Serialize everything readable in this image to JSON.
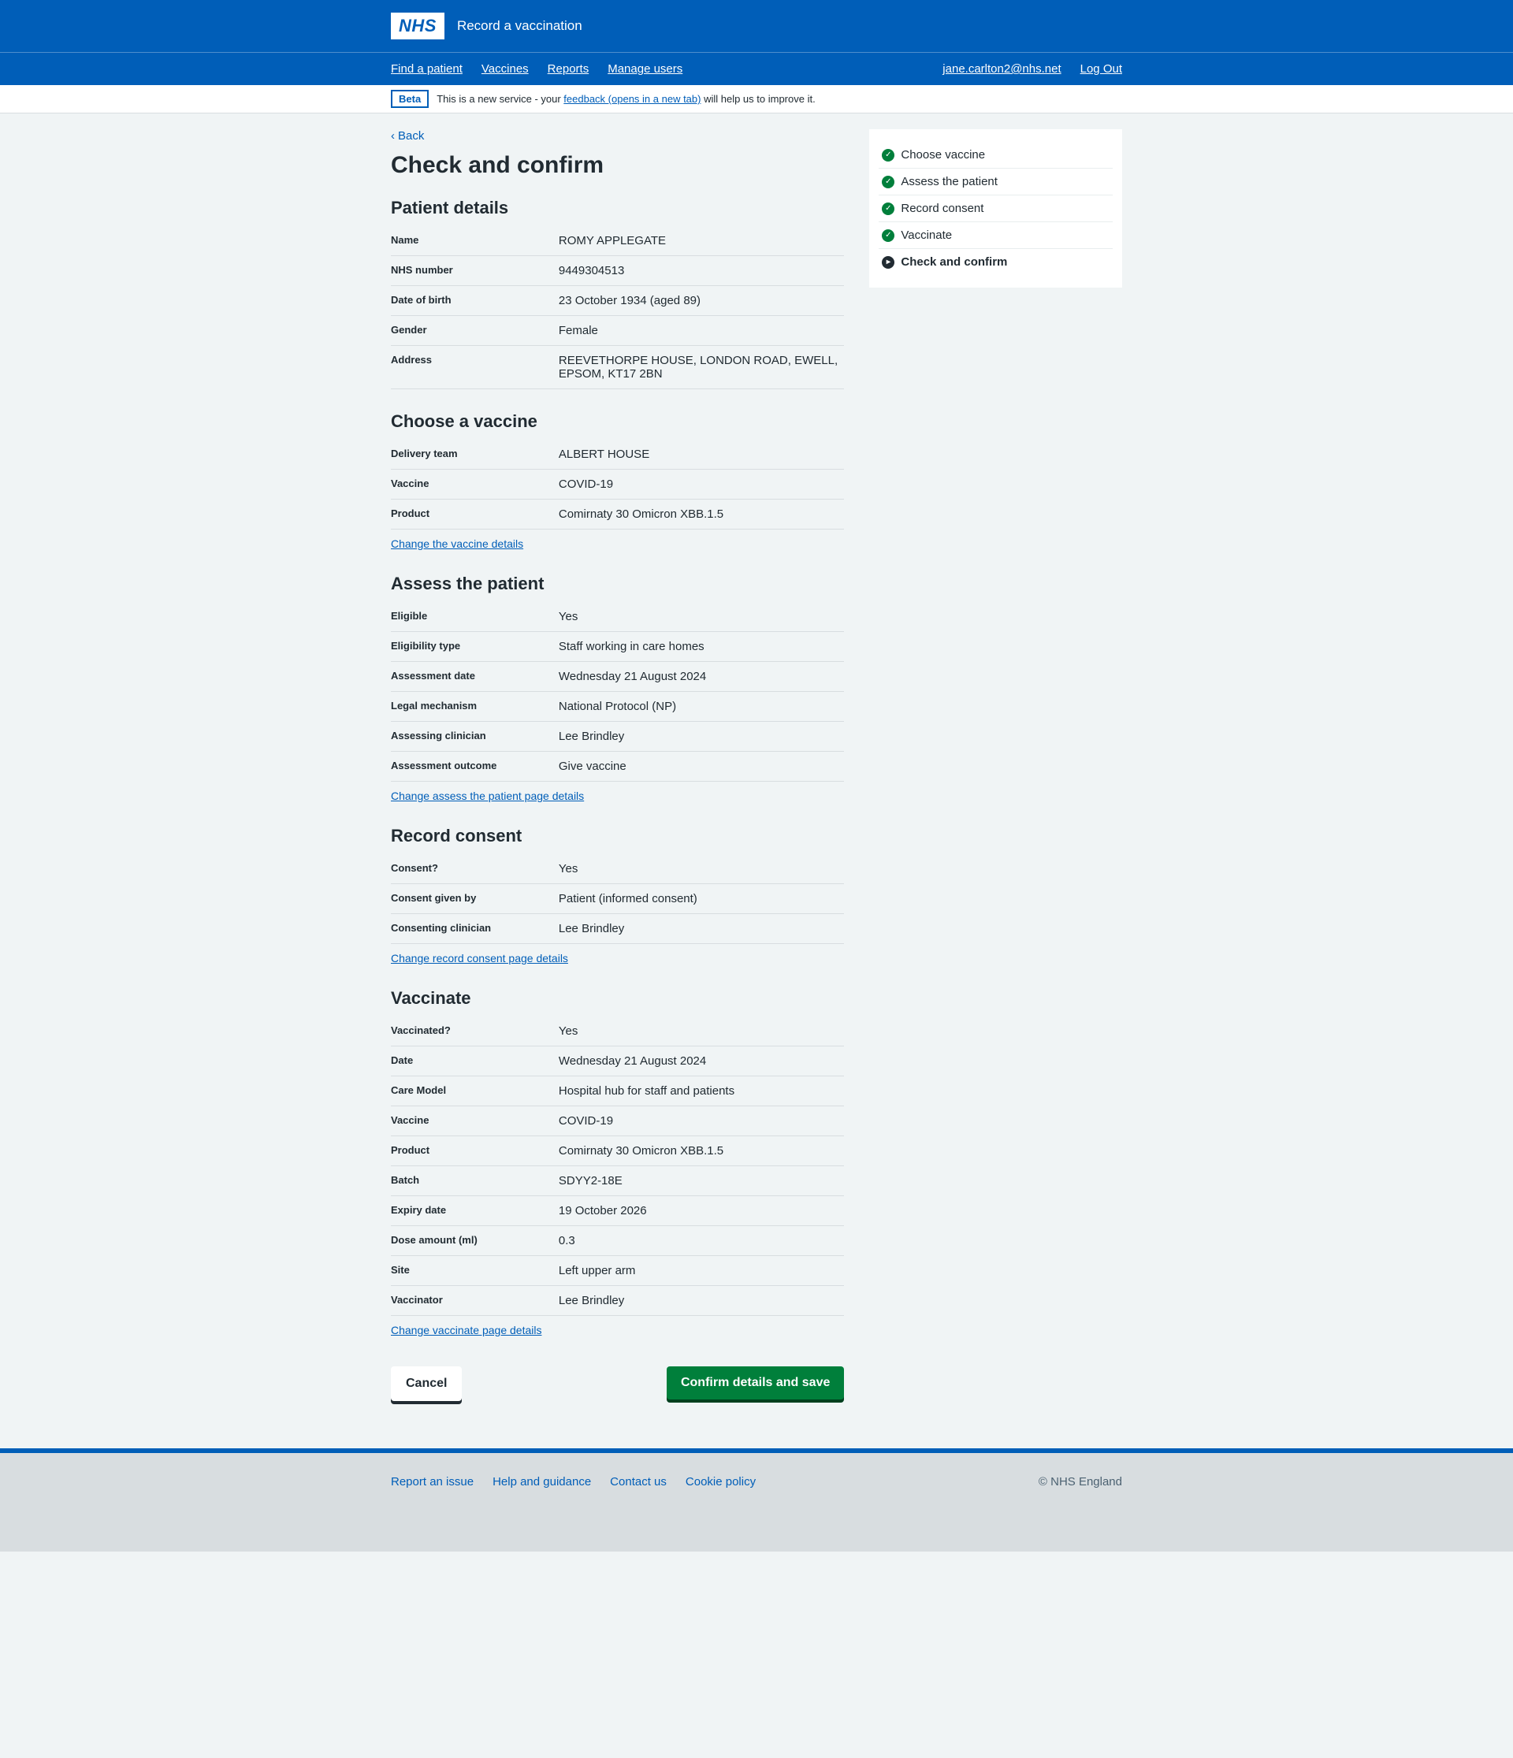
{
  "header": {
    "logo_text": "NHS",
    "service_name": "Record a vaccination"
  },
  "nav": {
    "left": [
      "Find a patient",
      "Vaccines",
      "Reports",
      "Manage users"
    ],
    "right": [
      "jane.carlton2@nhs.net",
      "Log Out"
    ]
  },
  "phase": {
    "tag": "Beta",
    "prefix": "This is a new service - your ",
    "link": "feedback (opens in a new tab)",
    "suffix": " will help us to improve it."
  },
  "back_label": "Back",
  "page_title": "Check and confirm",
  "progress": [
    {
      "label": "Choose vaccine",
      "done": true,
      "current": false
    },
    {
      "label": "Assess the patient",
      "done": true,
      "current": false
    },
    {
      "label": "Record consent",
      "done": true,
      "current": false
    },
    {
      "label": "Vaccinate",
      "done": true,
      "current": false
    },
    {
      "label": "Check and confirm",
      "done": false,
      "current": true
    }
  ],
  "sections": {
    "patient": {
      "title": "Patient details",
      "rows": [
        {
          "key": "Name",
          "val": "ROMY APPLEGATE"
        },
        {
          "key": "NHS number",
          "val": "9449304513"
        },
        {
          "key": "Date of birth",
          "val": "23 October 1934 (aged 89)"
        },
        {
          "key": "Gender",
          "val": "Female"
        },
        {
          "key": "Address",
          "val": "REEVETHORPE HOUSE, LONDON ROAD, EWELL, EPSOM, KT17 2BN"
        }
      ]
    },
    "vaccine": {
      "title": "Choose a vaccine",
      "rows": [
        {
          "key": "Delivery team",
          "val": "ALBERT HOUSE"
        },
        {
          "key": "Vaccine",
          "val": "COVID-19"
        },
        {
          "key": "Product",
          "val": "Comirnaty 30 Omicron XBB.1.5"
        }
      ],
      "change": "Change the vaccine details"
    },
    "assess": {
      "title": "Assess the patient",
      "rows": [
        {
          "key": "Eligible",
          "val": "Yes"
        },
        {
          "key": "Eligibility type",
          "val": "Staff working in care homes"
        },
        {
          "key": "Assessment date",
          "val": "Wednesday 21 August 2024"
        },
        {
          "key": "Legal mechanism",
          "val": "National Protocol (NP)"
        },
        {
          "key": "Assessing clinician",
          "val": "Lee Brindley"
        },
        {
          "key": "Assessment outcome",
          "val": "Give vaccine"
        }
      ],
      "change": "Change assess the patient page details"
    },
    "consent": {
      "title": "Record consent",
      "rows": [
        {
          "key": "Consent?",
          "val": "Yes"
        },
        {
          "key": "Consent given by",
          "val": "Patient (informed consent)"
        },
        {
          "key": "Consenting clinician",
          "val": "Lee Brindley"
        }
      ],
      "change": "Change record consent page details"
    },
    "vaccinate": {
      "title": "Vaccinate",
      "rows": [
        {
          "key": "Vaccinated?",
          "val": "Yes"
        },
        {
          "key": "Date",
          "val": "Wednesday 21 August 2024"
        },
        {
          "key": "Care Model",
          "val": "Hospital hub for staff and patients"
        },
        {
          "key": "Vaccine",
          "val": "COVID-19"
        },
        {
          "key": "Product",
          "val": "Comirnaty 30 Omicron XBB.1.5"
        },
        {
          "key": "Batch",
          "val": "SDYY2-18E"
        },
        {
          "key": "Expiry date",
          "val": "19 October 2026"
        },
        {
          "key": "Dose amount (ml)",
          "val": "0.3"
        },
        {
          "key": "Site",
          "val": "Left upper arm"
        },
        {
          "key": "Vaccinator",
          "val": "Lee Brindley"
        }
      ],
      "change": "Change vaccinate page details"
    }
  },
  "actions": {
    "cancel": "Cancel",
    "confirm": "Confirm details and save"
  },
  "footer": {
    "links": [
      "Report an issue",
      "Help and guidance",
      "Contact us",
      "Cookie policy"
    ],
    "copyright": "© NHS England"
  }
}
